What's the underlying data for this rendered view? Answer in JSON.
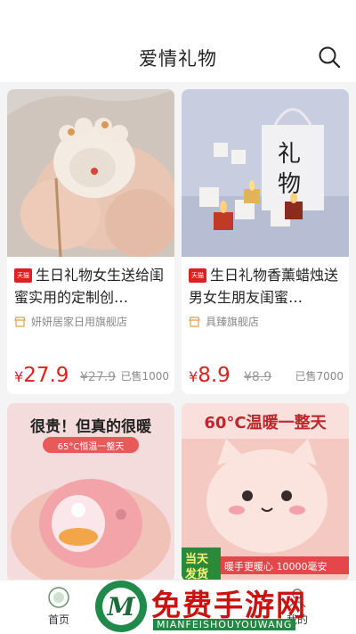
{
  "header": {
    "title": "爱情礼物"
  },
  "products": [
    {
      "tag": "天猫",
      "title": "生日礼物女生送给闺蜜实用的定制创…",
      "shop": "妍妍居家日用旗舰店",
      "currency": "¥",
      "price": "27.9",
      "orig": "¥27.9",
      "sold": "已售1000"
    },
    {
      "tag": "天猫",
      "title": "生日礼物香薰蜡烛送男女生朋友闺蜜…",
      "shop": "具臻旗舰店",
      "currency": "¥",
      "price": "8.9",
      "orig": "¥8.9",
      "sold": "已售7000"
    },
    {
      "img_text1": "很贵！但真的很暖",
      "img_text2": "65°C恒温一整天"
    },
    {
      "img_text1": "60°C温暖一整天",
      "img_text2": "暖手更暖心 10000毫安",
      "img_text3": "当天",
      "img_text4": "发货"
    }
  ],
  "img_texts": {
    "p1_sign1": "礼",
    "p1_sign2": "物"
  },
  "tabbar": {
    "home": "首页",
    "mine": "我的"
  },
  "watermark": {
    "title": "免费手游网",
    "sub": "MIANFEISHOUYOUWANG"
  }
}
